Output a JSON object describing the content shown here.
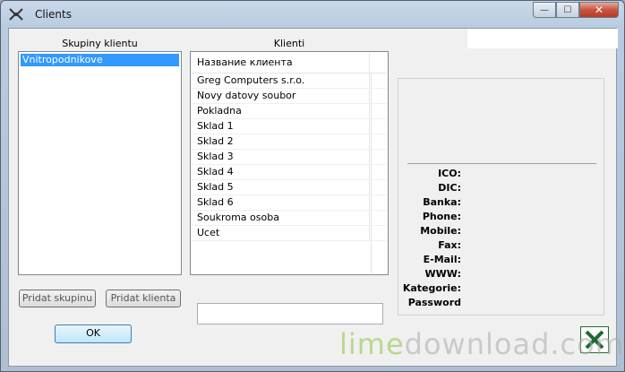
{
  "window": {
    "title": "Clients",
    "close_glyph": "✕",
    "minimize_glyph": "—",
    "maximize_glyph": "☐"
  },
  "groups": {
    "header": "Skupiny klientu",
    "items": [
      "Vnitropodnikove"
    ]
  },
  "clients": {
    "header": "Klienti",
    "column": "Название клиента",
    "rows": [
      "Greg Computers s.r.o.",
      "Novy datovy soubor",
      "Pokladna",
      "Sklad 1",
      "Sklad 2",
      "Sklad 3",
      "Sklad 4",
      "Sklad 5",
      "Sklad 6",
      "Soukroma osoba",
      "Ucet"
    ]
  },
  "details": {
    "labels": [
      "ICO:",
      "DIC:",
      "Banka:",
      "Phone:",
      "Mobile:",
      "Fax:",
      "E-Mail:",
      "WWW:",
      "Kategorie:",
      "Password"
    ]
  },
  "buttons": {
    "add_group": "Pridat skupinu",
    "add_client": "Pridat klienta",
    "ok": "OK"
  },
  "search": {
    "value": ""
  },
  "watermark": {
    "lime": "lime",
    "rest": "download.com"
  },
  "colors": {
    "selection": "#3399ff",
    "excel_green": "#1d6b2e"
  }
}
